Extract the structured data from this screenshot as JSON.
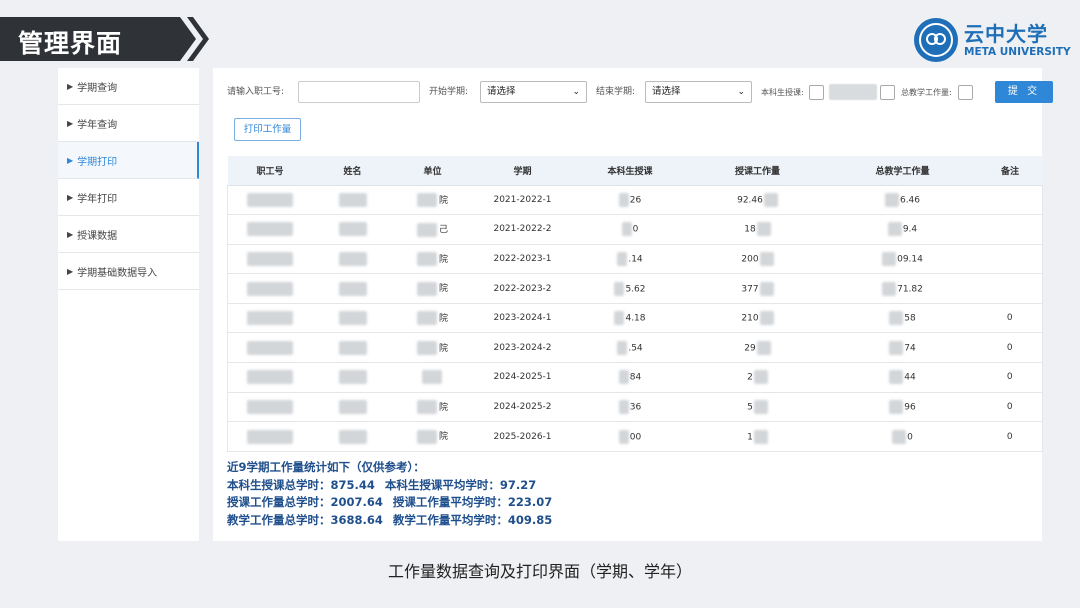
{
  "slide": {
    "title": "管理界面",
    "caption": "工作量数据查询及打印界面（学期、学年）",
    "logo_cn": "云中大学",
    "logo_en": "META UNIVERSITY"
  },
  "sidebar": {
    "items": [
      {
        "label": "学期查询"
      },
      {
        "label": "学年查询"
      },
      {
        "label": "学期打印"
      },
      {
        "label": "学年打印"
      },
      {
        "label": "授课数据"
      },
      {
        "label": "学期基础数据导入"
      }
    ]
  },
  "filters": {
    "staff_label": "请输入职工号:",
    "start_label": "开始学期:",
    "start_value": "请选择",
    "end_label": "结束学期:",
    "end_value": "请选择",
    "undergrad_label": "本科生授课:",
    "total_label": "总教学工作量:",
    "submit_label": "提 交",
    "print_label": "打印工作量"
  },
  "table": {
    "headers": [
      "职工号",
      "姓名",
      "单位",
      "学期",
      "本科生授课",
      "授课工作量",
      "总教学工作量",
      "备注"
    ],
    "rows": [
      {
        "unit": "院",
        "term": "2021-2022-1",
        "undergrad": "26",
        "teaching": "92.46",
        "total": "6.46",
        "remark": ""
      },
      {
        "unit": "己",
        "term": "2021-2022-2",
        "undergrad": "0",
        "teaching": "18",
        "total": "9.4",
        "remark": ""
      },
      {
        "unit": "院",
        "term": "2022-2023-1",
        "undergrad": ".14",
        "teaching": "200",
        "total": "09.14",
        "remark": ""
      },
      {
        "unit": "院",
        "term": "2022-2023-2",
        "undergrad": "5.62",
        "teaching": "377",
        "total": "71.82",
        "remark": ""
      },
      {
        "unit": "院",
        "term": "2023-2024-1",
        "undergrad": "4.18",
        "teaching": "210",
        "total": "58",
        "remark": "0"
      },
      {
        "unit": "院",
        "term": "2023-2024-2",
        "undergrad": ".54",
        "teaching": "29",
        "total": "74",
        "remark": "0"
      },
      {
        "unit": "",
        "term": "2024-2025-1",
        "undergrad": "84",
        "teaching": "2",
        "total": "44",
        "remark": "0"
      },
      {
        "unit": "院",
        "term": "2024-2025-2",
        "undergrad": "36",
        "teaching": "5",
        "total": "96",
        "remark": "0"
      },
      {
        "unit": "院",
        "term": "2025-2026-1",
        "undergrad": "00",
        "teaching": "1",
        "total": "0",
        "remark": "0"
      }
    ]
  },
  "summary": {
    "heading": "近9学期工作量统计如下（仅供参考）：",
    "undergrad_total": "本科生授课总学时：875.44",
    "undergrad_avg": "本科生授课平均学时：97.27",
    "teaching_total": "授课工作量总学时：2007.64",
    "teaching_avg": "授课工作量平均学时：223.07",
    "overall_total": "教学工作量总学时：3688.64",
    "overall_avg": "教学工作量平均学时：409.85"
  }
}
